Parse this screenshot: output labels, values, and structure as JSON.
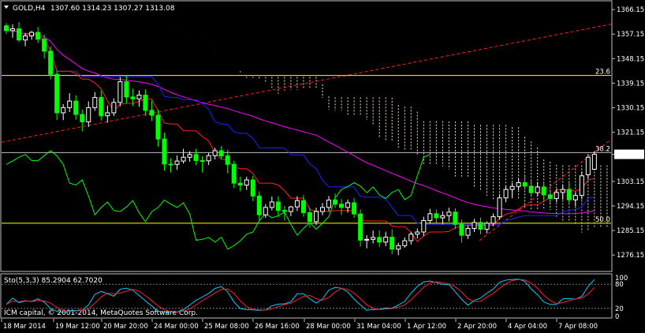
{
  "header": {
    "symbol": "GOLD,H4",
    "ohlc": "1307.60 1314.23 1307.27 1313.08"
  },
  "footer": {
    "copyright": "ICM capital, © 2001-2014, MetaQuotes Software Corp."
  },
  "stochastic": {
    "label": "Sto(5,3,3) 85.2904 62.7020",
    "levels": [
      "100",
      "80",
      "20",
      "0"
    ]
  },
  "fib_levels": [
    {
      "label": "23.6",
      "price": 1342.0
    },
    {
      "label": "38.2",
      "price": 1313.7
    },
    {
      "label": "50.0",
      "price": 1287.8
    }
  ],
  "current_price": {
    "label": "1313.08",
    "value": 1313.08
  },
  "colors": {
    "bull": "#ffffff",
    "bear": "#00ff00",
    "tenkan": "#ff2020",
    "kijun": "#2020ff",
    "chikou": "#00ff00",
    "sma": "#ff00ff",
    "cloud_a": "#f5deb3",
    "cloud_b": "#ffe4a0",
    "trend": "#ff2020",
    "fib": "#ffff00",
    "stoch_main": "#00ccff",
    "stoch_signal": "#ff2020"
  },
  "chart_data": {
    "type": "candlestick",
    "title": "GOLD,H4",
    "ylim": [
      1271.0,
      1368.5
    ],
    "y_ticks": [
      "1366.15",
      "1357.15",
      "1348.15",
      "1339.15",
      "1330.15",
      "1321.15",
      "1313.08",
      "1303.15",
      "1294.15",
      "1285.15",
      "1276.15"
    ],
    "x_ticks": [
      "18 Mar 2014",
      "19 Mar 12:00",
      "20 Mar 20:00",
      "24 Mar 00:00",
      "25 Mar 08:00",
      "26 Mar 16:00",
      "28 Mar 00:00",
      "31 Mar 04:00",
      "1 Apr 12:00",
      "2 Apr 20:00",
      "4 Apr 04:00",
      "7 Apr 08:00"
    ],
    "candles": [
      [
        1360.2,
        1361.2,
        1357.2,
        1358.4
      ],
      [
        1358.4,
        1360.7,
        1355.8,
        1359.1
      ],
      [
        1359.1,
        1361.5,
        1354.2,
        1355.0
      ],
      [
        1355.0,
        1357.6,
        1352.7,
        1356.5
      ],
      [
        1356.5,
        1358.3,
        1355.1,
        1357.8
      ],
      [
        1357.8,
        1359.8,
        1353.9,
        1355.3
      ],
      [
        1355.3,
        1357.0,
        1348.3,
        1350.9
      ],
      [
        1350.9,
        1352.6,
        1340.6,
        1342.4
      ],
      [
        1342.4,
        1343.7,
        1325.6,
        1328.3
      ],
      [
        1328.3,
        1331.5,
        1325.6,
        1330.2
      ],
      [
        1330.2,
        1335.5,
        1328.6,
        1332.6
      ],
      [
        1332.6,
        1334.7,
        1325.8,
        1327.7
      ],
      [
        1327.7,
        1329.5,
        1321.5,
        1325.0
      ],
      [
        1325.0,
        1332.5,
        1323.1,
        1330.2
      ],
      [
        1330.2,
        1335.9,
        1329.0,
        1333.9
      ],
      [
        1333.9,
        1336.5,
        1325.5,
        1327.2
      ],
      [
        1327.2,
        1331.0,
        1324.7,
        1328.3
      ],
      [
        1328.3,
        1333.6,
        1327.1,
        1332.1
      ],
      [
        1332.1,
        1341.4,
        1330.7,
        1339.7
      ],
      [
        1339.7,
        1342.0,
        1331.8,
        1334.1
      ],
      [
        1334.1,
        1337.1,
        1330.7,
        1333.4
      ],
      [
        1333.4,
        1336.5,
        1330.5,
        1334.8
      ],
      [
        1334.8,
        1336.9,
        1327.2,
        1329.2
      ],
      [
        1329.2,
        1332.8,
        1325.3,
        1327.4
      ],
      [
        1327.4,
        1329.4,
        1315.9,
        1318.7
      ],
      [
        1318.7,
        1321.0,
        1307.1,
        1309.5
      ],
      [
        1309.5,
        1311.6,
        1306.4,
        1309.4
      ],
      [
        1309.4,
        1312.7,
        1307.4,
        1310.6
      ],
      [
        1310.6,
        1315.1,
        1309.7,
        1312.0
      ],
      [
        1312.0,
        1314.2,
        1310.4,
        1313.0
      ],
      [
        1313.0,
        1315.1,
        1309.1,
        1310.8
      ],
      [
        1310.8,
        1312.4,
        1306.4,
        1310.7
      ],
      [
        1310.7,
        1313.6,
        1309.2,
        1312.6
      ],
      [
        1312.6,
        1315.5,
        1311.2,
        1314.4
      ],
      [
        1314.4,
        1316.1,
        1311.3,
        1312.5
      ],
      [
        1312.5,
        1314.7,
        1306.1,
        1309.4
      ],
      [
        1309.4,
        1310.7,
        1300.7,
        1302.5
      ],
      [
        1302.5,
        1304.9,
        1299.5,
        1301.8
      ],
      [
        1301.8,
        1304.9,
        1300.0,
        1303.7
      ],
      [
        1303.7,
        1305.2,
        1295.9,
        1297.8
      ],
      [
        1297.8,
        1299.5,
        1288.9,
        1290.9
      ],
      [
        1290.9,
        1294.8,
        1289.8,
        1293.6
      ],
      [
        1293.6,
        1297.6,
        1292.5,
        1295.6
      ],
      [
        1295.6,
        1297.7,
        1290.1,
        1292.5
      ],
      [
        1292.5,
        1294.1,
        1288.8,
        1292.1
      ],
      [
        1292.1,
        1294.2,
        1290.4,
        1293.8
      ],
      [
        1293.8,
        1297.7,
        1292.3,
        1296.1
      ],
      [
        1296.1,
        1298.1,
        1290.2,
        1291.7
      ],
      [
        1291.7,
        1293.5,
        1286.2,
        1288.4
      ],
      [
        1288.4,
        1293.5,
        1287.1,
        1292.1
      ],
      [
        1292.1,
        1295.2,
        1290.7,
        1293.6
      ],
      [
        1293.6,
        1297.8,
        1292.2,
        1296.3
      ],
      [
        1296.3,
        1298.7,
        1293.4,
        1294.8
      ],
      [
        1294.8,
        1296.7,
        1290.8,
        1293.6
      ],
      [
        1293.6,
        1296.5,
        1291.7,
        1295.3
      ],
      [
        1295.3,
        1297.0,
        1289.8,
        1291.2
      ],
      [
        1291.2,
        1292.9,
        1279.2,
        1281.6
      ],
      [
        1281.6,
        1283.4,
        1278.6,
        1281.9
      ],
      [
        1281.9,
        1285.1,
        1280.4,
        1282.6
      ],
      [
        1282.6,
        1285.2,
        1279.1,
        1280.9
      ],
      [
        1280.9,
        1284.7,
        1279.4,
        1282.7
      ],
      [
        1282.7,
        1285.6,
        1276.5,
        1278.3
      ],
      [
        1278.3,
        1280.7,
        1276.1,
        1279.6
      ],
      [
        1279.6,
        1282.6,
        1278.8,
        1281.4
      ],
      [
        1281.4,
        1284.7,
        1280.0,
        1283.8
      ],
      [
        1283.8,
        1285.9,
        1282.2,
        1284.6
      ],
      [
        1284.6,
        1290.2,
        1283.1,
        1288.8
      ],
      [
        1288.8,
        1293.1,
        1287.6,
        1291.3
      ],
      [
        1291.3,
        1292.8,
        1287.9,
        1289.8
      ],
      [
        1289.8,
        1292.2,
        1287.4,
        1290.6
      ],
      [
        1290.6,
        1293.5,
        1288.4,
        1291.9
      ],
      [
        1291.9,
        1293.3,
        1285.7,
        1287.4
      ],
      [
        1287.4,
        1289.2,
        1280.7,
        1283.4
      ],
      [
        1283.4,
        1287.0,
        1282.0,
        1285.9
      ],
      [
        1285.9,
        1289.4,
        1284.6,
        1288.1
      ],
      [
        1288.1,
        1289.9,
        1283.8,
        1285.6
      ],
      [
        1285.6,
        1288.5,
        1284.1,
        1287.8
      ],
      [
        1287.8,
        1291.4,
        1286.7,
        1290.2
      ],
      [
        1290.2,
        1298.5,
        1289.1,
        1297.1
      ],
      [
        1297.1,
        1301.5,
        1295.5,
        1300.2
      ],
      [
        1300.2,
        1302.6,
        1297.4,
        1301.3
      ],
      [
        1301.3,
        1304.1,
        1299.9,
        1302.7
      ],
      [
        1302.7,
        1305.1,
        1300.1,
        1301.4
      ],
      [
        1301.4,
        1303.5,
        1297.6,
        1299.0
      ],
      [
        1299.0,
        1302.9,
        1297.8,
        1301.1
      ],
      [
        1301.1,
        1302.4,
        1296.1,
        1298.2
      ],
      [
        1298.2,
        1300.2,
        1295.1,
        1296.9
      ],
      [
        1296.9,
        1300.4,
        1295.6,
        1299.1
      ],
      [
        1299.1,
        1301.8,
        1296.5,
        1300.2
      ],
      [
        1300.2,
        1303.3,
        1294.7,
        1296.4
      ],
      [
        1296.4,
        1299.1,
        1294.1,
        1298.0
      ],
      [
        1298.0,
        1306.8,
        1296.6,
        1305.2
      ],
      [
        1305.6,
        1313.2,
        1304.2,
        1312.0
      ],
      [
        1307.6,
        1314.23,
        1307.27,
        1313.08
      ]
    ]
  }
}
